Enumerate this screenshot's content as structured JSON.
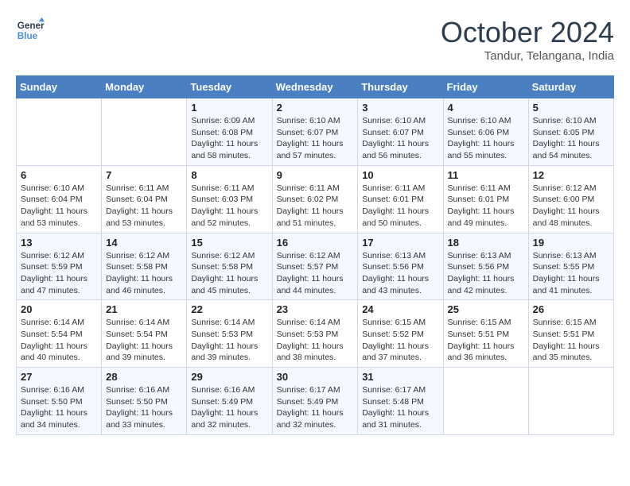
{
  "header": {
    "logo_line1": "General",
    "logo_line2": "Blue",
    "month": "October 2024",
    "location": "Tandur, Telangana, India"
  },
  "days_of_week": [
    "Sunday",
    "Monday",
    "Tuesday",
    "Wednesday",
    "Thursday",
    "Friday",
    "Saturday"
  ],
  "weeks": [
    [
      {
        "day": "",
        "info": ""
      },
      {
        "day": "",
        "info": ""
      },
      {
        "day": "1",
        "info": "Sunrise: 6:09 AM\nSunset: 6:08 PM\nDaylight: 11 hours and 58 minutes."
      },
      {
        "day": "2",
        "info": "Sunrise: 6:10 AM\nSunset: 6:07 PM\nDaylight: 11 hours and 57 minutes."
      },
      {
        "day": "3",
        "info": "Sunrise: 6:10 AM\nSunset: 6:07 PM\nDaylight: 11 hours and 56 minutes."
      },
      {
        "day": "4",
        "info": "Sunrise: 6:10 AM\nSunset: 6:06 PM\nDaylight: 11 hours and 55 minutes."
      },
      {
        "day": "5",
        "info": "Sunrise: 6:10 AM\nSunset: 6:05 PM\nDaylight: 11 hours and 54 minutes."
      }
    ],
    [
      {
        "day": "6",
        "info": "Sunrise: 6:10 AM\nSunset: 6:04 PM\nDaylight: 11 hours and 53 minutes."
      },
      {
        "day": "7",
        "info": "Sunrise: 6:11 AM\nSunset: 6:04 PM\nDaylight: 11 hours and 53 minutes."
      },
      {
        "day": "8",
        "info": "Sunrise: 6:11 AM\nSunset: 6:03 PM\nDaylight: 11 hours and 52 minutes."
      },
      {
        "day": "9",
        "info": "Sunrise: 6:11 AM\nSunset: 6:02 PM\nDaylight: 11 hours and 51 minutes."
      },
      {
        "day": "10",
        "info": "Sunrise: 6:11 AM\nSunset: 6:01 PM\nDaylight: 11 hours and 50 minutes."
      },
      {
        "day": "11",
        "info": "Sunrise: 6:11 AM\nSunset: 6:01 PM\nDaylight: 11 hours and 49 minutes."
      },
      {
        "day": "12",
        "info": "Sunrise: 6:12 AM\nSunset: 6:00 PM\nDaylight: 11 hours and 48 minutes."
      }
    ],
    [
      {
        "day": "13",
        "info": "Sunrise: 6:12 AM\nSunset: 5:59 PM\nDaylight: 11 hours and 47 minutes."
      },
      {
        "day": "14",
        "info": "Sunrise: 6:12 AM\nSunset: 5:58 PM\nDaylight: 11 hours and 46 minutes."
      },
      {
        "day": "15",
        "info": "Sunrise: 6:12 AM\nSunset: 5:58 PM\nDaylight: 11 hours and 45 minutes."
      },
      {
        "day": "16",
        "info": "Sunrise: 6:12 AM\nSunset: 5:57 PM\nDaylight: 11 hours and 44 minutes."
      },
      {
        "day": "17",
        "info": "Sunrise: 6:13 AM\nSunset: 5:56 PM\nDaylight: 11 hours and 43 minutes."
      },
      {
        "day": "18",
        "info": "Sunrise: 6:13 AM\nSunset: 5:56 PM\nDaylight: 11 hours and 42 minutes."
      },
      {
        "day": "19",
        "info": "Sunrise: 6:13 AM\nSunset: 5:55 PM\nDaylight: 11 hours and 41 minutes."
      }
    ],
    [
      {
        "day": "20",
        "info": "Sunrise: 6:14 AM\nSunset: 5:54 PM\nDaylight: 11 hours and 40 minutes."
      },
      {
        "day": "21",
        "info": "Sunrise: 6:14 AM\nSunset: 5:54 PM\nDaylight: 11 hours and 39 minutes."
      },
      {
        "day": "22",
        "info": "Sunrise: 6:14 AM\nSunset: 5:53 PM\nDaylight: 11 hours and 39 minutes."
      },
      {
        "day": "23",
        "info": "Sunrise: 6:14 AM\nSunset: 5:53 PM\nDaylight: 11 hours and 38 minutes."
      },
      {
        "day": "24",
        "info": "Sunrise: 6:15 AM\nSunset: 5:52 PM\nDaylight: 11 hours and 37 minutes."
      },
      {
        "day": "25",
        "info": "Sunrise: 6:15 AM\nSunset: 5:51 PM\nDaylight: 11 hours and 36 minutes."
      },
      {
        "day": "26",
        "info": "Sunrise: 6:15 AM\nSunset: 5:51 PM\nDaylight: 11 hours and 35 minutes."
      }
    ],
    [
      {
        "day": "27",
        "info": "Sunrise: 6:16 AM\nSunset: 5:50 PM\nDaylight: 11 hours and 34 minutes."
      },
      {
        "day": "28",
        "info": "Sunrise: 6:16 AM\nSunset: 5:50 PM\nDaylight: 11 hours and 33 minutes."
      },
      {
        "day": "29",
        "info": "Sunrise: 6:16 AM\nSunset: 5:49 PM\nDaylight: 11 hours and 32 minutes."
      },
      {
        "day": "30",
        "info": "Sunrise: 6:17 AM\nSunset: 5:49 PM\nDaylight: 11 hours and 32 minutes."
      },
      {
        "day": "31",
        "info": "Sunrise: 6:17 AM\nSunset: 5:48 PM\nDaylight: 11 hours and 31 minutes."
      },
      {
        "day": "",
        "info": ""
      },
      {
        "day": "",
        "info": ""
      }
    ]
  ]
}
